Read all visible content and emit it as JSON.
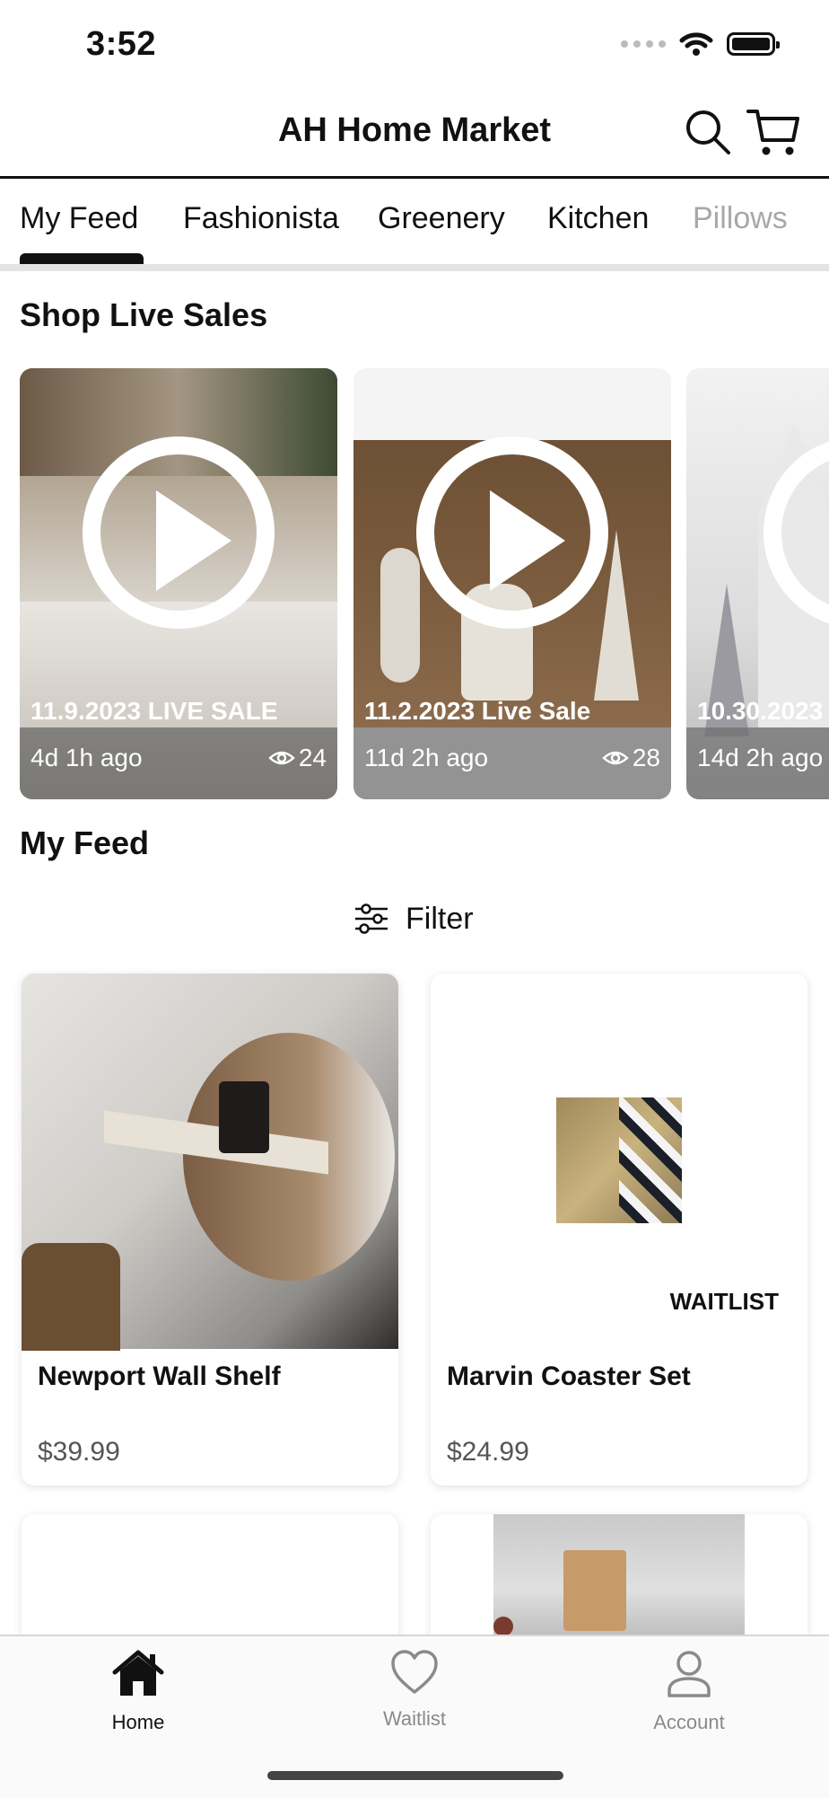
{
  "status_bar": {
    "time": "3:52"
  },
  "header": {
    "title": "AH Home Market",
    "search_icon": "search-icon",
    "cart_icon": "cart-icon"
  },
  "tabs": [
    {
      "label": "My Feed",
      "active": true
    },
    {
      "label": "Fashionista"
    },
    {
      "label": "Greenery"
    },
    {
      "label": "Kitchen"
    },
    {
      "label": "Pillows"
    }
  ],
  "live_sales": {
    "title": "Shop Live Sales",
    "items": [
      {
        "title": "11.9.2023 LIVE SALE",
        "ago": "4d 1h ago",
        "views": "24"
      },
      {
        "title": "11.2.2023 Live Sale",
        "ago": "11d 2h ago",
        "views": "28"
      },
      {
        "title": "10.30.2023",
        "ago": "14d 2h ago",
        "views": ""
      }
    ]
  },
  "feed": {
    "title": "My Feed",
    "filter_label": "Filter",
    "products": [
      {
        "name": "Newport Wall Shelf",
        "price": "$39.99",
        "badge": ""
      },
      {
        "name": "Marvin Coaster Set",
        "price": "$24.99",
        "badge": "WAITLIST"
      }
    ]
  },
  "bottom_nav": [
    {
      "label": "Home",
      "icon": "home-icon",
      "active": true
    },
    {
      "label": "Waitlist",
      "icon": "heart-icon"
    },
    {
      "label": "Account",
      "icon": "person-icon"
    }
  ],
  "colors": {
    "text": "#111111",
    "inactive": "#8a8a8a",
    "divider": "#e4e4e4"
  }
}
